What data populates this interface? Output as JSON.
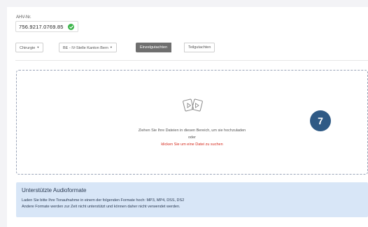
{
  "ahv": {
    "label": "AHV-Nr.",
    "value": "756.9217.0769.85",
    "status_icon": "check-circle-icon",
    "status_color": "#3bb54a"
  },
  "toolbar": {
    "specialty": "Chirurgie",
    "office": "BE - IV-Stelle Kanton Bern",
    "toggle_active": "Einzelgutachten",
    "toggle_inactive": "Teilgutachten"
  },
  "dropzone": {
    "icon": "audio-files-icon",
    "instruction": "Ziehen Sie Ihre Dateien in diesen Bereich, um sie hochzuladen",
    "or_text": "oder",
    "search_link": "klicken Sie um eine Datei zu suchen",
    "link_color": "#d52b1e"
  },
  "step_badge": {
    "number": "7",
    "color": "#2f5a85"
  },
  "info": {
    "title": "Unterstützte Audioformate",
    "line1": "Laden Sie bitte Ihre Tonaufnahme in einem der folgenden Formate hoch: MP3, MP4, DSS, DS2",
    "line2": "Andere Formate werden zur Zeit nicht unterstützt und können daher nicht verwendet werden.",
    "background": "#d8e6f7"
  }
}
